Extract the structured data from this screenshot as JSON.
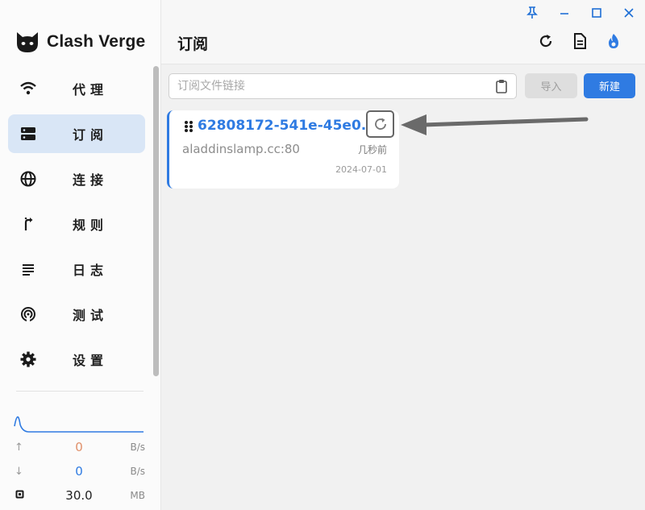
{
  "app": {
    "name": "Clash Verge"
  },
  "sidebar": {
    "items": [
      {
        "label": "代理",
        "icon": "wifi-icon",
        "active": false
      },
      {
        "label": "订阅",
        "icon": "server-icon",
        "active": true
      },
      {
        "label": "连接",
        "icon": "globe-icon",
        "active": false
      },
      {
        "label": "规则",
        "icon": "fork-icon",
        "active": false
      },
      {
        "label": "日志",
        "icon": "lines-icon",
        "active": false
      },
      {
        "label": "测试",
        "icon": "broadcast-icon",
        "active": false
      },
      {
        "label": "设置",
        "icon": "gear-icon",
        "active": false
      }
    ]
  },
  "traffic": {
    "upload": {
      "value": "0",
      "unit": "B/s"
    },
    "download": {
      "value": "0",
      "unit": "B/s"
    },
    "memory": {
      "value": "30.0",
      "unit": "MB"
    }
  },
  "header": {
    "title": "订阅"
  },
  "import_bar": {
    "placeholder": "订阅文件链接",
    "import_label": "导入",
    "new_label": "新建"
  },
  "profile": {
    "name": "62808172-541e-45e0...",
    "host": "aladdinslamp.cc:80",
    "updated": "几秒前",
    "date": "2024-07-01"
  },
  "colors": {
    "accent": "#2f7be2",
    "active_bg": "#d9e6f6",
    "upload": "#e0906a",
    "download": "#2f7be2"
  }
}
